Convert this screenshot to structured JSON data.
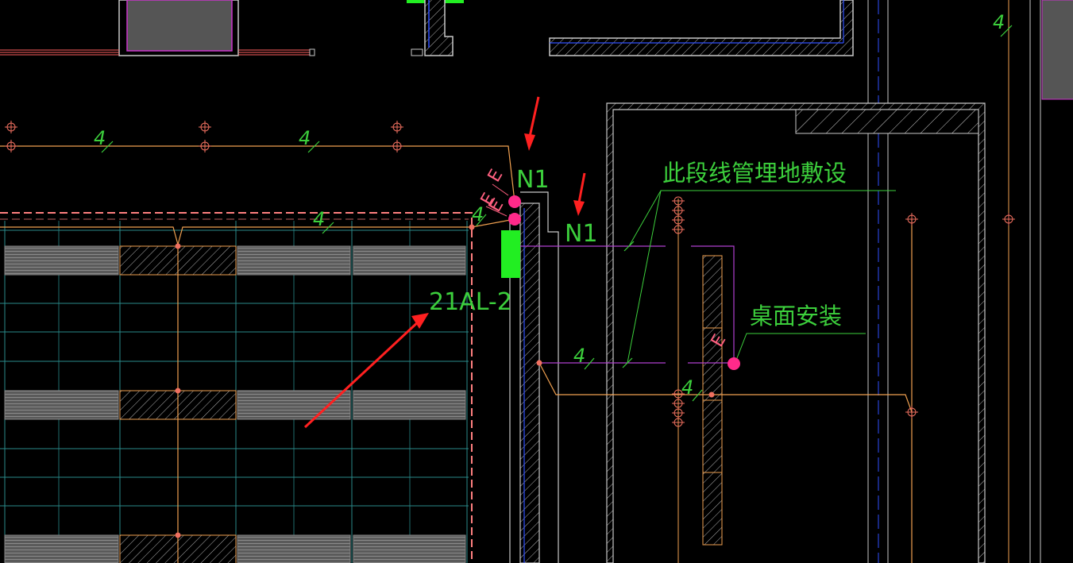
{
  "drawing": {
    "labels": {
      "n1_top": "N1",
      "n1_right": "N1",
      "circuit": "21AL-2",
      "note_underground": "此段线管埋地敷设",
      "note_desk": "桌面安装",
      "wire_count_1": "4",
      "wire_count_2": "4",
      "wire_count_3": "4",
      "wire_count_4": "4",
      "wire_count_5": "4",
      "wire_count_6": "4",
      "wire_count_7": "4",
      "socket_mark_1": "E",
      "socket_mark_2": "E",
      "socket_mark_3": "E",
      "socket_mark_4": "E"
    },
    "colors": {
      "background": "#000000",
      "wire": "#f0a050",
      "wall": "#c8c8c8",
      "grid": "#2a8a8a",
      "magenta_line": "#b040d0",
      "socket": "#ff2a8a",
      "arrow": "#ff2020",
      "label": "#3ccf3c",
      "panel": "#22ee22",
      "boundary": "#ff8080",
      "blue_line": "#3050ff"
    }
  }
}
